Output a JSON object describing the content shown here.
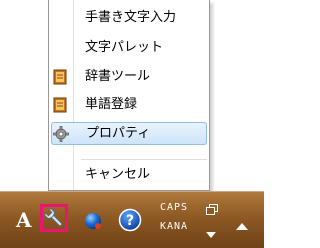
{
  "menu": {
    "items": [
      {
        "label": "手書き文字入力",
        "icon": null
      },
      {
        "label": "文字パレット",
        "icon": null
      },
      {
        "label": "辞書ツール",
        "icon": "dictionary-book-icon"
      },
      {
        "label": "単語登録",
        "icon": "word-register-book-icon"
      },
      {
        "label": "プロパティ",
        "icon": "gear-icon",
        "highlighted": true
      },
      {
        "label": "キャンセル",
        "icon": null
      }
    ]
  },
  "language_bar": {
    "input_mode": "A",
    "tool_icon": "wrench-icon",
    "highlight_color": "#e8166e",
    "status_icon": "blue-ball-icon",
    "help_icon": "help-icon",
    "caps_label": "CAPS",
    "kana_label": "KANA"
  },
  "colors": {
    "taskbar": "#8e5a24",
    "menu_highlight_border": "#93bde6"
  }
}
